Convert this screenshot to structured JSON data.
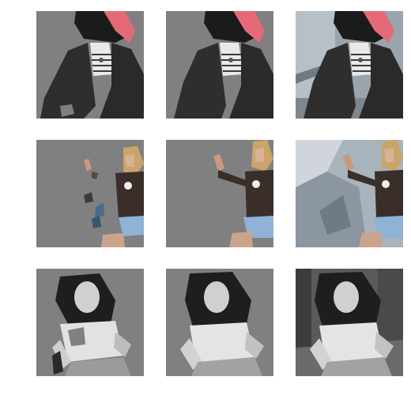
{
  "layout": {
    "rows": 3,
    "cols": 3
  },
  "panels": [
    {
      "id": "r1c1",
      "subject": "woman-pink-hair-cardigan",
      "variant": "masked-partial"
    },
    {
      "id": "r1c2",
      "subject": "woman-pink-hair-cardigan",
      "variant": "masked-clean"
    },
    {
      "id": "r1c3",
      "subject": "woman-pink-hair-cardigan",
      "variant": "composited-background"
    },
    {
      "id": "r2c1",
      "subject": "woman-selfie-denim-shorts",
      "variant": "masked-partial"
    },
    {
      "id": "r2c2",
      "subject": "woman-selfie-denim-shorts",
      "variant": "masked-clean"
    },
    {
      "id": "r2c3",
      "subject": "woman-selfie-denim-shorts",
      "variant": "composited-background"
    },
    {
      "id": "r3c1",
      "subject": "woman-grayscale-pose",
      "variant": "masked-partial"
    },
    {
      "id": "r3c2",
      "subject": "woman-grayscale-pose",
      "variant": "masked-clean"
    },
    {
      "id": "r3c3",
      "subject": "woman-grayscale-pose",
      "variant": "composited-background"
    }
  ],
  "colors": {
    "mask_background": "#808080",
    "page_background": "#ffffff"
  }
}
